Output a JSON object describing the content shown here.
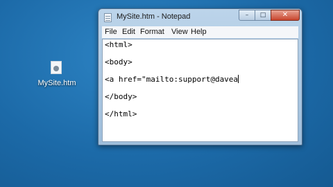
{
  "desktop": {
    "icon_label": "MySite.htm"
  },
  "window": {
    "title": "MySite.htm - Notepad",
    "minimize_glyph": "–",
    "maximize_glyph": "□",
    "close_glyph": "✕"
  },
  "menu": {
    "file": "File",
    "edit": "Edit",
    "format": "Format",
    "view": "View",
    "help": "Help"
  },
  "editor": {
    "lines": [
      "<html>",
      "<body>",
      "<a href=\"mailto:support@davea",
      "</body>",
      "</html>"
    ]
  }
}
